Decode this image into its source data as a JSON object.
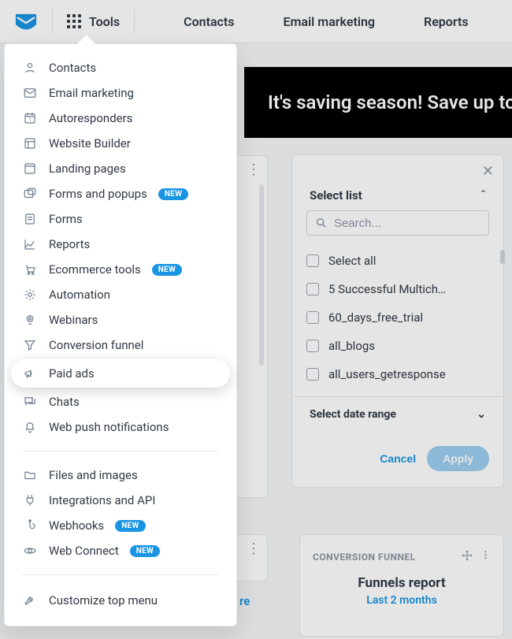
{
  "header": {
    "tools_label": "Tools",
    "nav": [
      "Contacts",
      "Email marketing",
      "Reports"
    ]
  },
  "banner": {
    "text": "It's saving season! Save up to"
  },
  "tools_menu": {
    "group1": [
      {
        "icon": "contacts",
        "label": "Contacts"
      },
      {
        "icon": "envelope",
        "label": "Email marketing"
      },
      {
        "icon": "calendar",
        "label": "Autoresponders"
      },
      {
        "icon": "layout",
        "label": "Website Builder"
      },
      {
        "icon": "landing",
        "label": "Landing pages"
      },
      {
        "icon": "popup",
        "label": "Forms and popups",
        "badge": "NEW"
      },
      {
        "icon": "form",
        "label": "Forms"
      },
      {
        "icon": "chart",
        "label": "Reports"
      },
      {
        "icon": "cart",
        "label": "Ecommerce tools",
        "badge": "NEW"
      },
      {
        "icon": "gear",
        "label": "Automation"
      },
      {
        "icon": "webcam",
        "label": "Webinars"
      },
      {
        "icon": "funnel",
        "label": "Conversion funnel"
      },
      {
        "icon": "megaphone",
        "label": "Paid ads",
        "highlight": true
      },
      {
        "icon": "chat",
        "label": "Chats"
      },
      {
        "icon": "bell",
        "label": "Web push notifications"
      }
    ],
    "group2": [
      {
        "icon": "folder",
        "label": "Files and images"
      },
      {
        "icon": "plug",
        "label": "Integrations and API"
      },
      {
        "icon": "hook",
        "label": "Webhooks",
        "badge": "NEW"
      },
      {
        "icon": "orbit",
        "label": "Web Connect",
        "badge": "NEW"
      }
    ],
    "customize_label": "Customize top menu"
  },
  "select_list": {
    "title": "Select list",
    "search_placeholder": "Search...",
    "items": [
      "Select all",
      "5 Successful Multich…",
      "60_days_free_trial",
      "all_blogs",
      "all_users_getresponse"
    ],
    "date_range_label": "Select date range",
    "cancel": "Cancel",
    "apply": "Apply"
  },
  "funnel_card": {
    "kicker": "CONVERSION FUNNEL",
    "title": "Funnels report",
    "subtitle": "Last 2 months"
  },
  "peek_text": "re"
}
